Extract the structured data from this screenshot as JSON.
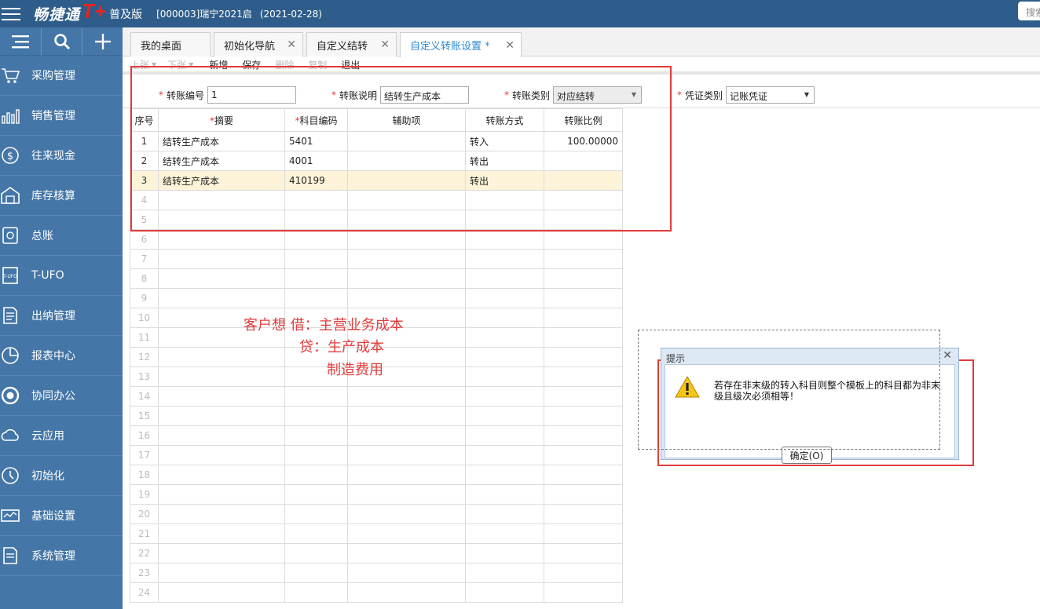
{
  "header": {
    "logo_text": "畅捷通",
    "logo_mark": "T+",
    "edition": "普及版",
    "account": "[000003]瑞宁2021启",
    "date": "(2021-02-28)",
    "search_placeholder": "搜索"
  },
  "sidebar": {
    "tools": [
      {
        "icon": "list-icon"
      },
      {
        "icon": "search-icon"
      },
      {
        "icon": "plus-icon"
      }
    ],
    "items": [
      {
        "label": "采购管理",
        "icon": "cart-icon"
      },
      {
        "label": "销售管理",
        "icon": "bar-chart-icon"
      },
      {
        "label": "往来现金",
        "icon": "dollar-icon"
      },
      {
        "label": "库存核算",
        "icon": "warehouse-icon"
      },
      {
        "label": "总账",
        "icon": "ledger-icon"
      },
      {
        "label": "T-UFO",
        "icon": "ufo-icon"
      },
      {
        "label": "出纳管理",
        "icon": "cashier-icon"
      },
      {
        "label": "报表中心",
        "icon": "pie-chart-icon"
      },
      {
        "label": "协同办公",
        "icon": "target-icon"
      },
      {
        "label": "云应用",
        "icon": "cloud-icon"
      },
      {
        "label": "初始化",
        "icon": "clock-icon"
      },
      {
        "label": "基础设置",
        "icon": "settings-icon"
      },
      {
        "label": "系统管理",
        "icon": "document-icon"
      }
    ]
  },
  "tabs": [
    {
      "label": "我的桌面",
      "closable": false,
      "active": false
    },
    {
      "label": "初始化导航",
      "closable": true,
      "active": false
    },
    {
      "label": "自定义结转",
      "closable": true,
      "active": false
    },
    {
      "label": "自定义转账设置 *",
      "closable": true,
      "active": true
    }
  ],
  "toolbar": {
    "prev": "上张",
    "next": "下张",
    "add": "新增",
    "save": "保存",
    "delete": "删除",
    "copy": "复制",
    "exit": "退出"
  },
  "form": {
    "transfer_no_label": "转账编号",
    "transfer_no_value": "1",
    "desc_label": "转账说明",
    "desc_value": "结转生产成本",
    "type_label": "转账类别",
    "type_value": "对应结转",
    "voucher_label": "凭证类别",
    "voucher_value": "记账凭证"
  },
  "grid": {
    "columns": [
      "序号",
      "摘要",
      "科目编码",
      "辅助项",
      "转账方式",
      "转账比例"
    ],
    "rows": [
      {
        "idx": "1",
        "summary": "结转生产成本",
        "code": "5401",
        "aux": "",
        "dir": "转入",
        "ratio": "100.00000"
      },
      {
        "idx": "2",
        "summary": "结转生产成本",
        "code": "4001",
        "aux": "",
        "dir": "转出",
        "ratio": ""
      },
      {
        "idx": "3",
        "summary": "结转生产成本",
        "code": "410199",
        "aux": "",
        "dir": "转出",
        "ratio": ""
      }
    ],
    "empty_rows": [
      "4",
      "5",
      "6",
      "7",
      "8",
      "9",
      "10",
      "11",
      "12",
      "13",
      "14",
      "15",
      "16",
      "17",
      "18",
      "19",
      "20",
      "21",
      "22",
      "23",
      "24"
    ]
  },
  "annotation": {
    "line1": "客户想  借：主营业务成本",
    "line2": "贷：生产成本",
    "line3": "制造费用"
  },
  "dialog": {
    "title": "提示",
    "message": "若存在非末级的转入科目则整个模板上的科目都为非末级且级次必须相等！",
    "ok_label": "确定(O)"
  },
  "colors": {
    "topbar": "#2f5d8b",
    "sidebar": "#4476a7",
    "accent": "#2f8ad6",
    "annotation": "#e23b3b",
    "selected_row": "#fdf3d9"
  }
}
